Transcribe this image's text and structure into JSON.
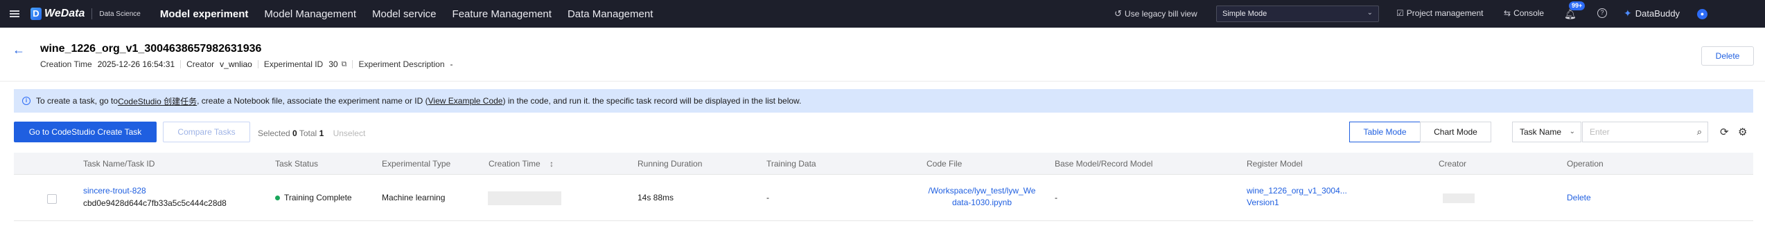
{
  "topnav": {
    "brand": "WeData",
    "brand_sub": "Data Science",
    "items": [
      {
        "label": "Model experiment",
        "active": true
      },
      {
        "label": "Model Management",
        "active": false
      },
      {
        "label": "Model service",
        "active": false
      },
      {
        "label": "Feature Management",
        "active": false
      },
      {
        "label": "Data Management",
        "active": false
      }
    ],
    "legacy_label": "Use legacy bill view",
    "mode_value": "Simple Mode",
    "project_label": "Project management",
    "console_label": "Console",
    "notif_badge": "99+",
    "buddy_label": "DataBuddy"
  },
  "experiment": {
    "title": "wine_1226_org_v1_3004638657982631936",
    "creation_time_label": "Creation Time",
    "creation_time": "2025-12-26 16:54:31",
    "creator_label": "Creator",
    "creator": "v_wnliao",
    "id_label": "Experimental ID",
    "id": "30",
    "desc_label": "Experiment Description",
    "desc": "-",
    "delete_label": "Delete"
  },
  "banner": {
    "t1": "To create a task, go to ",
    "link1": "CodeStudio 创建任务",
    "t2": ", create a Notebook file, associate the experiment name or ID (",
    "link2": "View Example Code",
    "t3": ") in the code, and run it. the specific task record will be displayed in the list below."
  },
  "toolbar": {
    "create_label": "Go to CodeStudio Create Task",
    "compare_label": "Compare Tasks",
    "selected_label": "Selected",
    "selected_count": "0",
    "total_label": "Total",
    "total_count": "1",
    "unselect_label": "Unselect",
    "table_mode": "Table Mode",
    "chart_mode": "Chart Mode",
    "filter_field": "Task Name",
    "search_placeholder": "Enter"
  },
  "table": {
    "headers": {
      "task": "Task Name/Task ID",
      "status": "Task Status",
      "type": "Experimental Type",
      "creation_time": "Creation Time",
      "duration": "Running Duration",
      "training_data": "Training Data",
      "code_file": "Code File",
      "base_model": "Base Model/Record Model",
      "register_model": "Register Model",
      "creator": "Creator",
      "operation": "Operation"
    },
    "rows": [
      {
        "task_name": "sincere-trout-828",
        "task_id": "cbd0e9428d644c7fb33a5c5c444c28d8",
        "status": "Training Complete",
        "type": "Machine learning",
        "duration": "14s 88ms",
        "training_data": "-",
        "code_file_1": "/Workspace/lyw_test/lyw_We",
        "code_file_2": "data-1030.ipynb",
        "base_model": "-",
        "register_model_1": "wine_1226_org_v1_3004...",
        "register_model_2": "Version1",
        "operation": "Delete"
      }
    ]
  }
}
